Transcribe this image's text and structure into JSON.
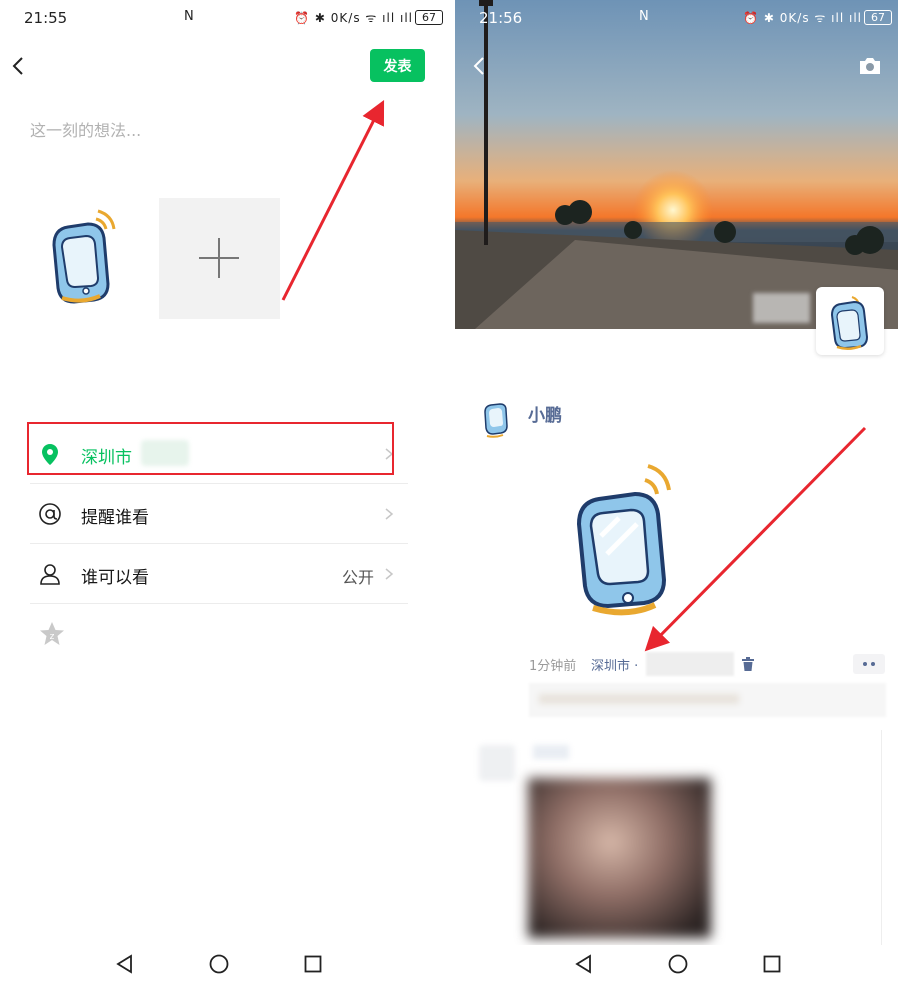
{
  "left": {
    "status": {
      "time": "21:55",
      "nfc": "N",
      "netspeed_value": "0",
      "netspeed_unit": "K/s",
      "battery": "67"
    },
    "header": {
      "publish_label": "发表"
    },
    "compose": {
      "placeholder": "这一刻的想法..."
    },
    "rows": [
      {
        "label": "深圳市",
        "value": ""
      },
      {
        "label": "提醒谁看",
        "value": ""
      },
      {
        "label": "谁可以看",
        "value": "公开"
      }
    ]
  },
  "right": {
    "status": {
      "time": "21:56",
      "nfc": "N",
      "netspeed_value": "0",
      "netspeed_unit": "K/s",
      "battery": "67"
    },
    "post": {
      "author": "小鹏",
      "time": "1分钟前",
      "location": "深圳市 ·"
    }
  },
  "colors": {
    "wechat_green": "#07c160",
    "link_blue": "#576b95",
    "annotation_red": "#e8262f"
  },
  "icons": [
    "chevron-left-icon",
    "location-pin-icon",
    "at-icon",
    "person-icon",
    "chevron-right-icon",
    "star-icon",
    "camera-icon",
    "trash-icon",
    "more-icon",
    "nav-back-icon",
    "nav-home-icon",
    "nav-recents-icon"
  ]
}
